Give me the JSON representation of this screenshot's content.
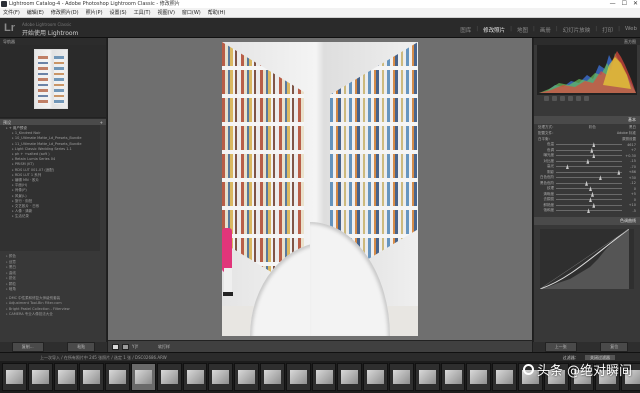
{
  "window": {
    "title": "Lightroom Catalog-4 - Adobe Photoshop Lightroom Classic - 修改照片",
    "controls": [
      "—",
      "☐",
      "✕"
    ]
  },
  "menu": [
    "文件(F)",
    "编辑(E)",
    "修改照片(D)",
    "照片(P)",
    "设置(S)",
    "工具(T)",
    "视图(V)",
    "窗口(W)",
    "帮助(H)"
  ],
  "identity": {
    "logo": "Lr",
    "small_text": "Adobe Lightroom Classic",
    "title": "开始使用 Lightroom"
  },
  "modules": {
    "items": [
      "图库",
      "修改照片",
      "地图",
      "画册",
      "幻灯片放映",
      "打印",
      "Web"
    ],
    "active_index": 1
  },
  "left_panel": {
    "navigator_label": "导航器",
    "presets_label": "预设",
    "presets": [
      {
        "label": "+ 用户预设",
        "folder": true
      },
      {
        "label": "1_Kindred Noir",
        "folder": false
      },
      {
        "label": "10_Ultimate Matte_Ld_Presets_Bundle",
        "folder": false
      },
      {
        "label": "11_Ultimate Matte_Ld_Presets_Bundle",
        "folder": false
      },
      {
        "label": "Light Classic Wedding Series 1.1",
        "folder": false
      },
      {
        "label": "ph + +salted (soft )",
        "folder": false
      },
      {
        "label": "Retain Lumia Series 04",
        "folder": false
      },
      {
        "label": "PRISM (KT)",
        "folder": false
      },
      {
        "label": "RDS LUT 001-07 (适配)",
        "folder": false
      },
      {
        "label": "RDS LUT 1 系列",
        "folder": false
      },
      {
        "label": "编辑 MN · 胶片",
        "folder": false
      },
      {
        "label": "平面(H)",
        "folder": false
      },
      {
        "label": "肖像(P)",
        "folder": false
      },
      {
        "label": "风景(L)",
        "folder": false
      },
      {
        "label": "旅行 · 街拍",
        "folder": false
      },
      {
        "label": "文艺胶片 · 日系",
        "folder": false
      },
      {
        "label": "人像 · 清新",
        "folder": false
      },
      {
        "label": "生活记录",
        "folder": false
      }
    ],
    "groups": [
      "颜色",
      "创意",
      "黑白",
      "曲线",
      "锐化",
      "颗粒",
      "暗角"
    ],
    "bottom_items": [
      "DMC 中性柔和修复大师级别套装",
      "Adjustment Tool-Bin Filter.com",
      "Bright Pastel Collection - Filterview",
      "CAMERA 专业人像技法大全"
    ],
    "copy_button": "复制...",
    "paste_button": "粘贴"
  },
  "toolbar": {
    "text": "软打样"
  },
  "right_panel": {
    "histogram_label": "直方图",
    "basic_label": "基本",
    "treatment_label": "处理方式：",
    "treatment_options": [
      "彩色",
      "黑白"
    ],
    "profile_label": "配置文件：",
    "profile_value": "Adobe 标准",
    "wb_label": "白平衡：",
    "wb_value": "原照设置",
    "sliders": [
      {
        "label": "色温",
        "value": "4617",
        "pos": 0.55
      },
      {
        "label": "色调",
        "value": "+7",
        "pos": 0.52
      },
      {
        "label": "曝光度",
        "value": "+0.30",
        "pos": 0.55
      },
      {
        "label": "对比度",
        "value": "-15",
        "pos": 0.46
      },
      {
        "label": "高光",
        "value": "-70",
        "pos": 0.15
      },
      {
        "label": "阴影",
        "value": "+86",
        "pos": 0.93
      },
      {
        "label": "白色色阶",
        "value": "+30",
        "pos": 0.65
      },
      {
        "label": "黑色色阶",
        "value": "-12",
        "pos": 0.44
      },
      {
        "label": "纹理",
        "value": "0",
        "pos": 0.5
      },
      {
        "label": "清晰度",
        "value": "+5",
        "pos": 0.53
      },
      {
        "label": "去朦胧",
        "value": "0",
        "pos": 0.5
      },
      {
        "label": "鲜艳度",
        "value": "+10",
        "pos": 0.55
      },
      {
        "label": "饱和度",
        "value": "-5",
        "pos": 0.47
      }
    ],
    "tone_curve_label": "色调曲线",
    "prev_button": "上一张",
    "reset_button": "复位"
  },
  "filmstrip": {
    "info": "上一次导入 / 在所有照片中 245 张照片 / 选定 1 张 / DSC02686.ARW",
    "filter_label": "过滤器：",
    "filter_value": "关闭过滤器",
    "selected_index": 5,
    "count": 25
  },
  "watermark": "头条 @绝对瞬间"
}
